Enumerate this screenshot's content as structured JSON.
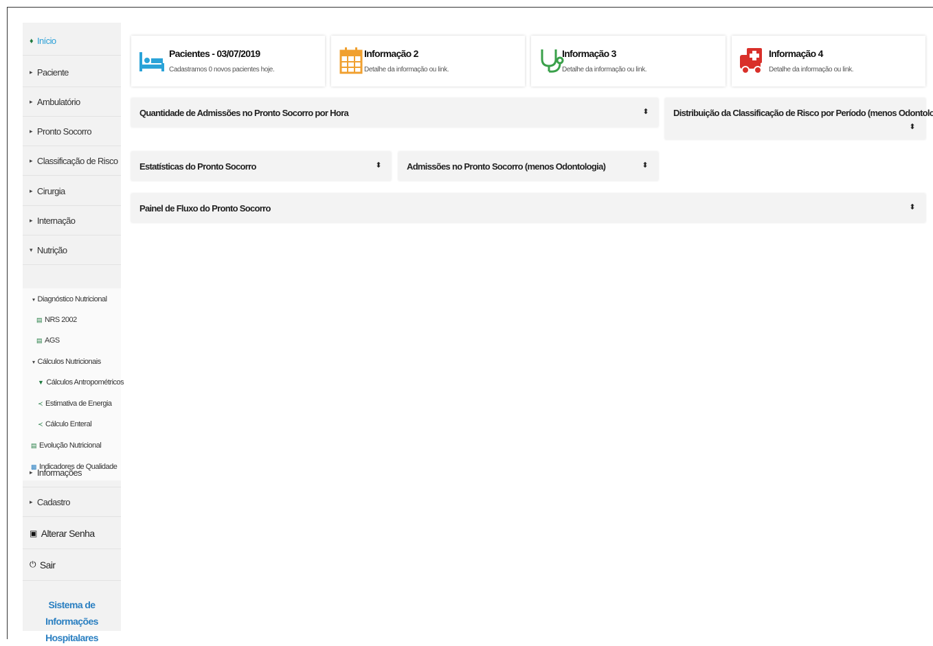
{
  "sidebar": {
    "items": [
      {
        "label": "Início",
        "icon": "home-icon"
      },
      {
        "label": "Paciente"
      },
      {
        "label": "Ambulatório"
      },
      {
        "label": "Pronto Socorro"
      },
      {
        "label": "Classificação de Risco"
      },
      {
        "label": "Cirurgia"
      },
      {
        "label": "Internação"
      },
      {
        "label": "Nutrição"
      },
      {
        "label": "Informações"
      },
      {
        "label": "Cadastro"
      },
      {
        "label": "Alterar Senha",
        "icon": "lock-icon"
      },
      {
        "label": "Sair",
        "icon": "power-icon"
      }
    ],
    "nutricao_sub": [
      {
        "label": "Diagnóstico Nutricional"
      },
      {
        "label": "NRS 2002"
      },
      {
        "label": "AGS"
      },
      {
        "label": "Cálculos Nutricionais"
      },
      {
        "label": "Cálculos Antropométricos"
      },
      {
        "label": "Estimativa de Energia"
      },
      {
        "label": "Cálculo Enteral"
      },
      {
        "label": "Evolução Nutricional"
      },
      {
        "label": "Indicadores de Qualidade"
      }
    ],
    "brand": "Sistema de Informações Hospitalares"
  },
  "cards": [
    {
      "title": "Pacientes - 03/07/2019",
      "subtitle": "Cadastramos 0 novos pacientes hoje.",
      "icon": "hospital-bed-icon",
      "color": "#2aa3d8"
    },
    {
      "title": "Informação 2",
      "subtitle": "Detalhe da informação ou link.",
      "icon": "calendar-icon",
      "color": "#f0a030"
    },
    {
      "title": "Informação 3",
      "subtitle": "Detalhe da informação ou link.",
      "icon": "stethoscope-icon",
      "color": "#3aa04a"
    },
    {
      "title": "Informação 4",
      "subtitle": "Detalhe da informação ou link.",
      "icon": "ambulance-icon",
      "color": "#d9302a"
    }
  ],
  "panels": [
    {
      "title": "Quantidade de Admissões no Pronto Socorro por Hora"
    },
    {
      "title": "Distribuição da Classificação de Risco por Período (menos Odontologia)"
    },
    {
      "title": "Estatísticas do Pronto Socorro"
    },
    {
      "title": "Admissões no Pronto Socorro (menos Odontologia)"
    },
    {
      "title": "Painel de Fluxo do Pronto Socorro"
    }
  ],
  "toggle_symbol": "⬍"
}
